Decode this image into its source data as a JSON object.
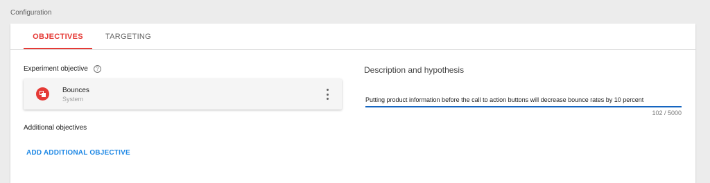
{
  "section": {
    "label": "Configuration"
  },
  "tabs": [
    {
      "label": "OBJECTIVES",
      "active": true
    },
    {
      "label": "TARGETING",
      "active": false
    }
  ],
  "objectives": {
    "heading": "Experiment objective",
    "help_icon": "?",
    "primary": {
      "name": "Bounces",
      "type": "System",
      "icon": "bounce-icon"
    },
    "additional_heading": "Additional objectives",
    "add_button": "ADD ADDITIONAL OBJECTIVE"
  },
  "description": {
    "label": "Description and hypothesis",
    "value": "Putting product information before the call to action buttons will decrease bounce rates by 10 percent",
    "char_count": "102 / 5000"
  },
  "colors": {
    "accent": "#e53935",
    "link": "#1e88e5",
    "input_underline": "#1565c0"
  }
}
